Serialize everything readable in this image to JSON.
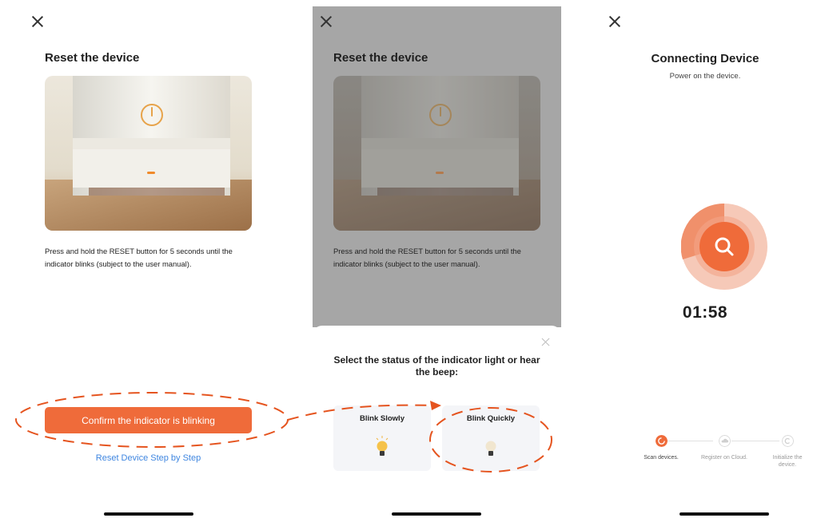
{
  "screen1": {
    "title": "Reset the device",
    "description": "Press and hold the RESET button for 5 seconds until the indicator blinks (subject to the user manual).",
    "confirm_button": "Confirm the indicator is blinking",
    "reset_link": "Reset Device Step by Step"
  },
  "screen2": {
    "title": "Reset the device",
    "description": "Press and hold the RESET button for 5 seconds until the indicator blinks (subject to the user manual).",
    "sheet_title": "Select the status of the indicator light or hear the beep:",
    "options": [
      {
        "label": "Blink Slowly",
        "icon": "lit-bulb-icon"
      },
      {
        "label": "Blink Quickly",
        "icon": "dim-bulb-icon"
      }
    ]
  },
  "screen3": {
    "title": "Connecting Device",
    "subtitle": "Power on the device.",
    "timer": "01:58",
    "steps": [
      {
        "label": "Scan devices.",
        "state": "active"
      },
      {
        "label": "Register on Cloud.",
        "state": "pending"
      },
      {
        "label": "Initialize the device.",
        "state": "pending"
      }
    ]
  },
  "colors": {
    "accent": "#ef6b3a",
    "link": "#3f86e0",
    "annotation": "#e5541f",
    "overlay": "#a6a6a6"
  }
}
